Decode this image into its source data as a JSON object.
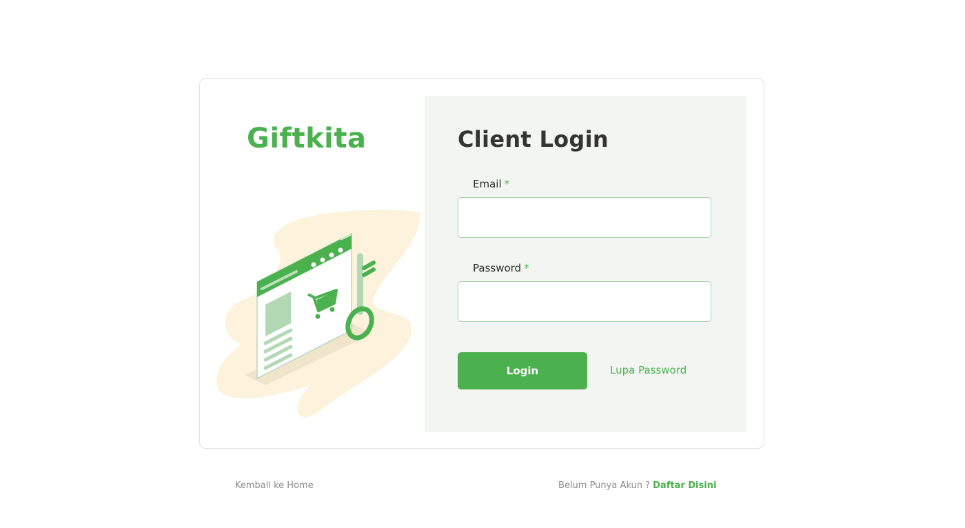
{
  "brand": {
    "logo_text": "Giftkita",
    "color": "#4ab14e"
  },
  "form": {
    "title": "Client Login",
    "email_label": "Email",
    "password_label": "Password",
    "required_mark": "*",
    "email_value": "",
    "password_value": "",
    "login_label": "Login",
    "forgot_label": "Lupa Password"
  },
  "footer": {
    "home_link": "Kembali ke Home",
    "no_account_text": "Belum Punya Akun ?",
    "register_link": "Daftar Disini"
  },
  "illustration": {
    "icon": "shopping-cart-icon",
    "key_icon": "key-icon"
  },
  "colors": {
    "accent": "#4ab14e",
    "panel_bg": "#f3f5f2",
    "blob": "#fdf3dc",
    "text_dark": "#343434",
    "text_muted": "#8a8a8a"
  }
}
